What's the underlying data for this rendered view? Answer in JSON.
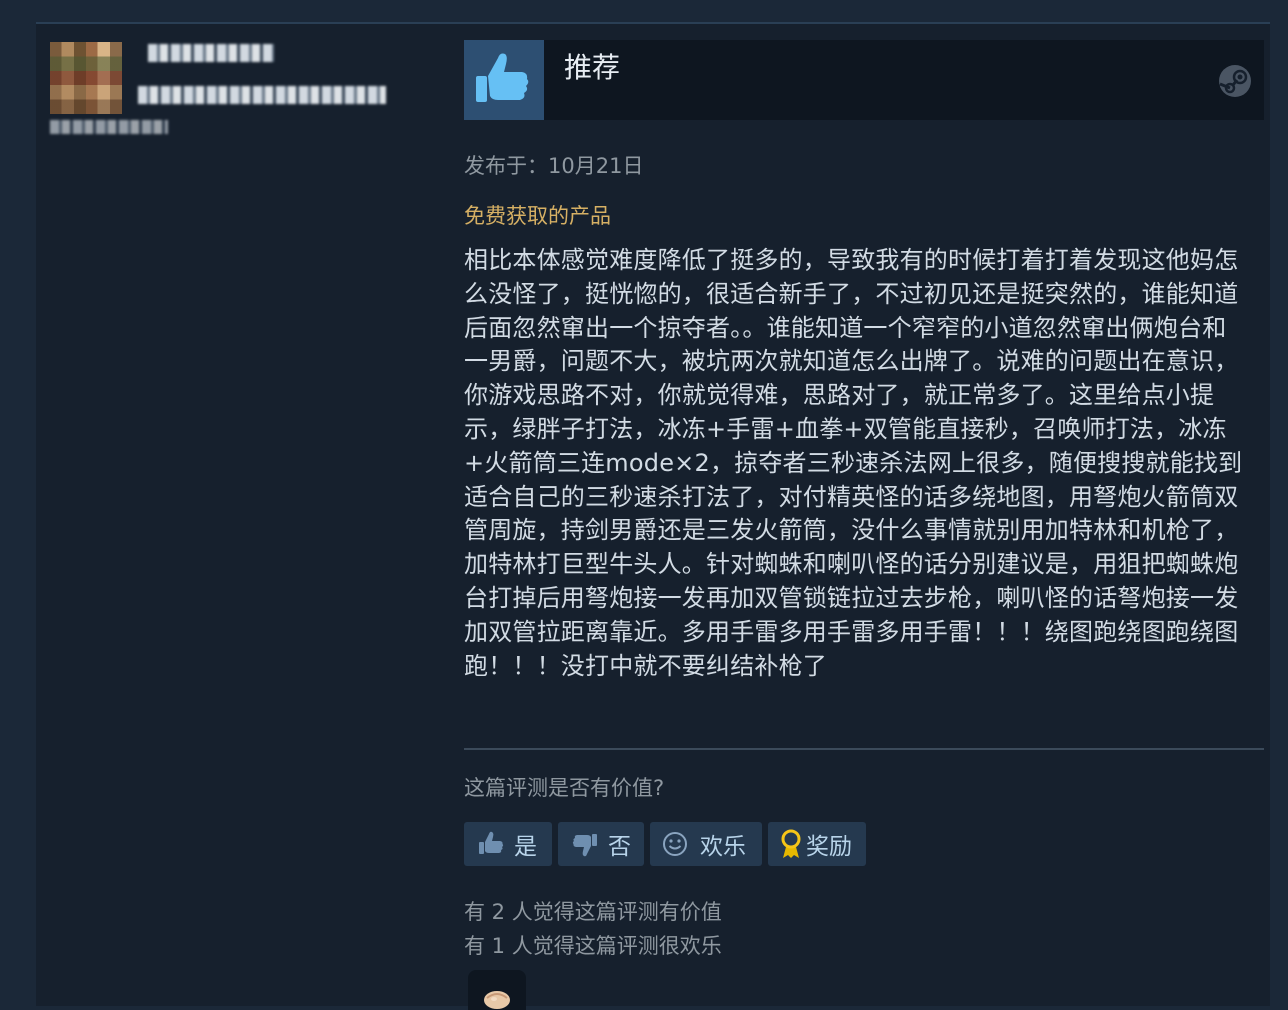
{
  "review": {
    "verdict": "推荐",
    "posted_label": "发布于：10月21日",
    "free_label": "免费获取的产品",
    "body": "相比本体感觉难度降低了挺多的，导致我有的时候打着打着发现这他妈怎么没怪了，挺恍惚的，很适合新手了，不过初见还是挺突然的，谁能知道后面忽然窜出一个掠夺者。。谁能知道一个窄窄的小道忽然窜出俩炮台和一男爵，问题不大，被坑两次就知道怎么出牌了。说难的问题出在意识，你游戏思路不对，你就觉得难，思路对了，就正常多了。这里给点小提示，绿胖子打法，冰冻+手雷+血拳+双管能直接秒，召唤师打法，冰冻+火箭筒三连mode×2，掠夺者三秒速杀法网上很多，随便搜搜就能找到适合自己的三秒速杀打法了，对付精英怪的话多绕地图，用弩炮火箭筒双管周旋，持剑男爵还是三发火箭筒，没什么事情就别用加特林和机枪了，加特林打巨型牛头人。针对蜘蛛和喇叭怪的话分别建议是，用狙把蜘蛛炮台打掉后用弩炮接一发再加双管锁链拉过去步枪，喇叭怪的话弩炮接一发加双管拉距离靠近。多用手雷多用手雷多用手雷！！！绕图跑绕图跑绕图跑！！！没打中就不要纠结补枪了"
  },
  "feedback": {
    "question": "这篇评测是否有价值?",
    "buttons": {
      "yes": "是",
      "no": "否",
      "funny": "欢乐",
      "award": "奖励"
    },
    "helpful_count_text": "有 2 人觉得这篇评测有价值",
    "funny_count_text": "有 1 人觉得这篇评测很欢乐"
  },
  "colors": {
    "page_bg": "#1b2838",
    "card_bg": "#16202d",
    "accent_free": "#d6b064",
    "button_bg": "#25394f",
    "thumb_box": "#2d4f72"
  },
  "icons": {
    "verdict": "thumbs-up-icon",
    "brand": "steam-logo-icon",
    "yes": "thumbs-up-icon",
    "no": "thumbs-down-icon",
    "funny": "smiley-icon",
    "award": "award-ribbon-icon"
  }
}
